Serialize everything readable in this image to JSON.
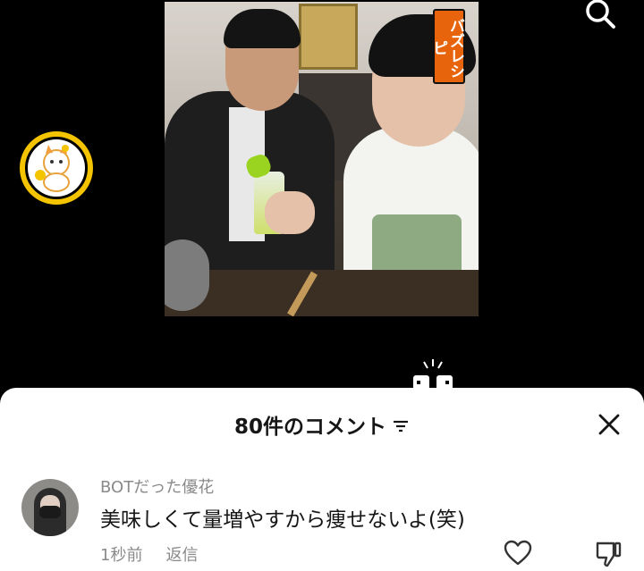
{
  "video": {
    "badge": "バズレシピ"
  },
  "icons": {
    "search": "search-icon",
    "coin": "lucky-cat-coin-icon",
    "cheers": "cheers-icon",
    "sort": "sort-icon",
    "close": "close-icon",
    "like": "heart-icon",
    "dislike": "thumbs-down-icon"
  },
  "comments_sheet": {
    "title": "80件のコメント",
    "comments": [
      {
        "username": "BOTだった優花",
        "text": "美味しくて量増やすから痩せないよ(笑)",
        "time": "1秒前",
        "reply_label": "返信"
      }
    ]
  },
  "colors": {
    "badge": "#e8640c",
    "coin": "#f5c400",
    "sheet": "#ffffff"
  }
}
